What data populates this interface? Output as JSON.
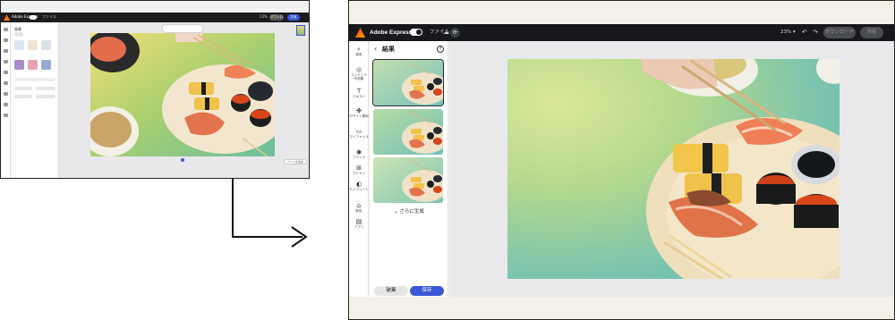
{
  "thumbnail": {
    "app_title": "Adobe Express",
    "panel_title": "画像",
    "zoom": "13%",
    "download_label": "ダウンロード",
    "share_label": "共有",
    "page_pill": "ページを追加"
  },
  "app": {
    "title": "Adobe Express",
    "file_menu": "ファイル",
    "zoom_label": "23%",
    "download_label": "ダウンロード",
    "share_label": "共有"
  },
  "left_rail": {
    "items": [
      {
        "icon": "search-icon",
        "label": "検索"
      },
      {
        "icon": "content-icon",
        "label": "コンテンツ 作品集"
      },
      {
        "icon": "text-icon",
        "label": "テキスト"
      },
      {
        "icon": "design-icon",
        "label": "デザイン素材"
      },
      {
        "icon": "file-icon",
        "label": "マイファイル"
      },
      {
        "icon": "brand-icon",
        "label": "ブランド"
      },
      {
        "icon": "addon-icon",
        "label": "アドオン"
      },
      {
        "icon": "template-icon",
        "label": "テンプレート"
      },
      {
        "icon": "palette-icon",
        "label": "配色"
      },
      {
        "icon": "apps-icon",
        "label": "アプリ"
      }
    ]
  },
  "panel": {
    "title": "結果",
    "more_label": "さらに生成",
    "discard_label": "破棄",
    "save_label": "保存",
    "results_count_visible": 3,
    "selected_index": 0
  },
  "colors": {
    "accent": "#3a57d6",
    "topbar": "#16181b",
    "background": "#f4f1e8"
  }
}
